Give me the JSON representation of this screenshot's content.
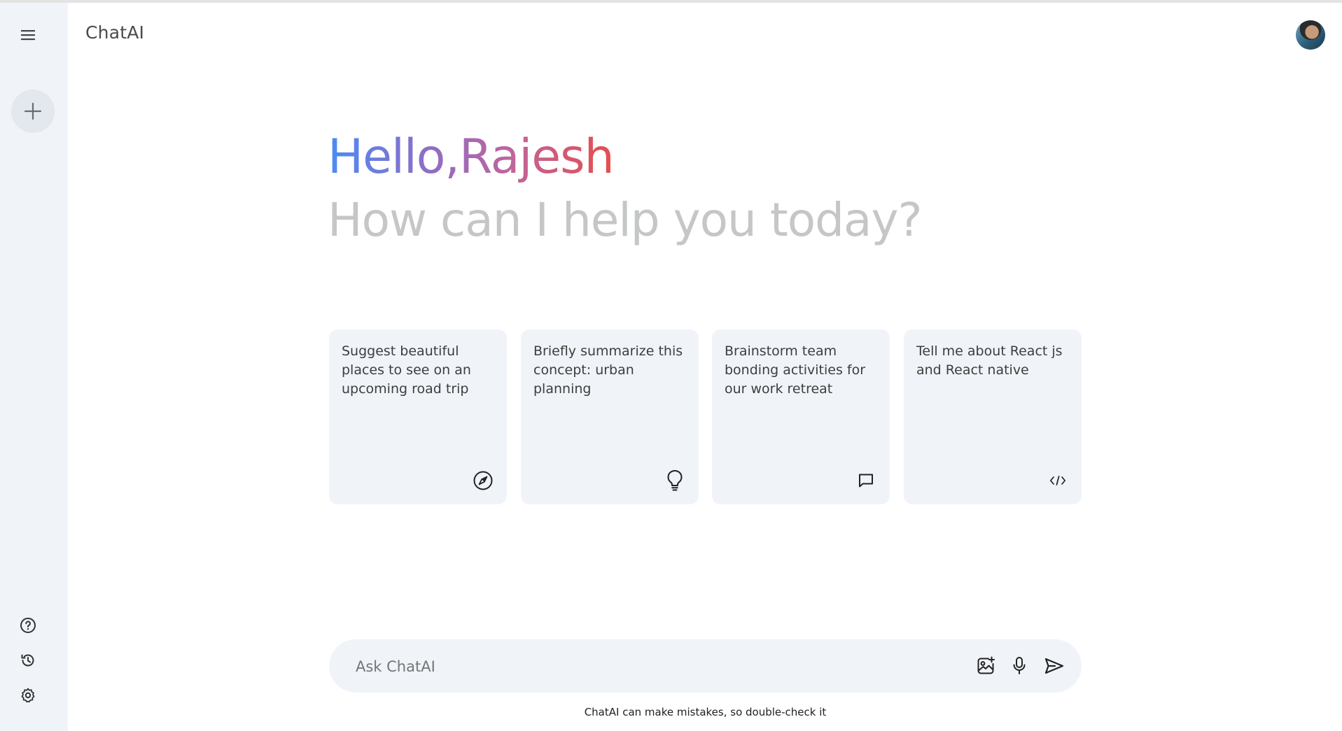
{
  "app": {
    "title": "ChatAI"
  },
  "greeting": {
    "hello": "Hello,",
    "name": "Rajesh",
    "subheading": "How can I help you today?"
  },
  "cards": [
    {
      "text": "Suggest beautiful places to see on an upcoming road trip",
      "icon": "compass-icon"
    },
    {
      "text": "Briefly summarize this concept: urban planning",
      "icon": "bulb-icon"
    },
    {
      "text": "Brainstorm team bonding activities for our work retreat",
      "icon": "message-icon"
    },
    {
      "text": "Tell me about React js and React native",
      "icon": "code-icon"
    }
  ],
  "prompt": {
    "placeholder": "Ask ChatAI",
    "value": ""
  },
  "disclaimer": "ChatAI can make mistakes, so double-check it",
  "colors": {
    "sidebar_bg": "#f0f4f9",
    "card_bg": "#f0f4f9",
    "gradient_start": "#4b8bf5",
    "gradient_end": "#e54d4d",
    "subheading": "#c4c7c5"
  }
}
